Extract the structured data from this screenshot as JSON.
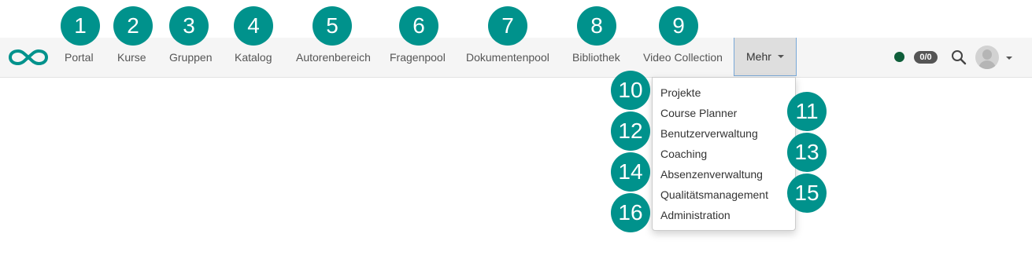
{
  "navbar": {
    "items": [
      {
        "label": "Portal"
      },
      {
        "label": "Kurse"
      },
      {
        "label": "Gruppen"
      },
      {
        "label": "Katalog"
      },
      {
        "label": "Autorenbereich"
      },
      {
        "label": "Fragenpool"
      },
      {
        "label": "Dokumentenpool"
      },
      {
        "label": "Bibliothek"
      },
      {
        "label": "Video Collection"
      }
    ],
    "more_label": "Mehr",
    "status_badge": "0/0",
    "icons": [
      "infinity-logo-icon",
      "search-icon",
      "avatar",
      "chevron-down-icon"
    ]
  },
  "dropdown": {
    "items": [
      {
        "label": "Projekte"
      },
      {
        "label": "Course Planner"
      },
      {
        "label": "Benutzerverwaltung"
      },
      {
        "label": "Coaching"
      },
      {
        "label": "Absenzenverwaltung"
      },
      {
        "label": "Qualitätsmanagement"
      },
      {
        "label": "Administration"
      }
    ]
  },
  "markers": [
    "1",
    "2",
    "3",
    "4",
    "5",
    "6",
    "7",
    "8",
    "9",
    "10",
    "11",
    "12",
    "13",
    "14",
    "15",
    "16"
  ],
  "colors": {
    "accent_teal": "#00928c",
    "status_green": "#0f5e3a",
    "navbar_bg": "#f5f5f5",
    "more_active_bg": "#dedede"
  }
}
